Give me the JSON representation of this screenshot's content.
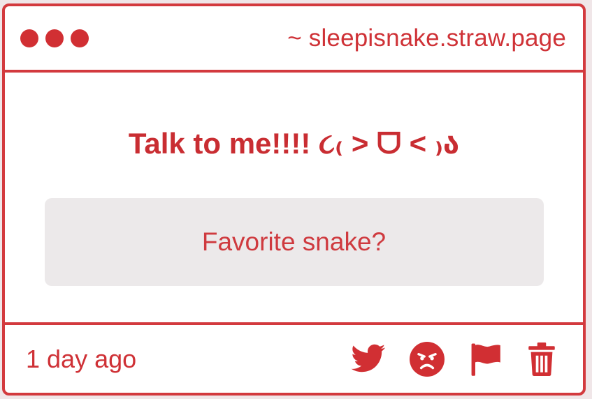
{
  "window": {
    "site_url": "~ sleepisnake.straw.page"
  },
  "main": {
    "title": "Talk to me!!!! ૮₍ ˃ ᗜ ˂ ₎ა",
    "question": "Favorite snake?"
  },
  "footer": {
    "timestamp": "1 day ago",
    "actions": [
      {
        "name": "twitter",
        "icon": "twitter-icon"
      },
      {
        "name": "angry",
        "icon": "angry-face-icon"
      },
      {
        "name": "report",
        "icon": "flag-icon"
      },
      {
        "name": "delete",
        "icon": "trash-icon"
      }
    ]
  },
  "colors": {
    "accent": "#d12f33",
    "border": "#d33a3e",
    "question_bg": "#ece9ea",
    "background": "#ffffff"
  }
}
